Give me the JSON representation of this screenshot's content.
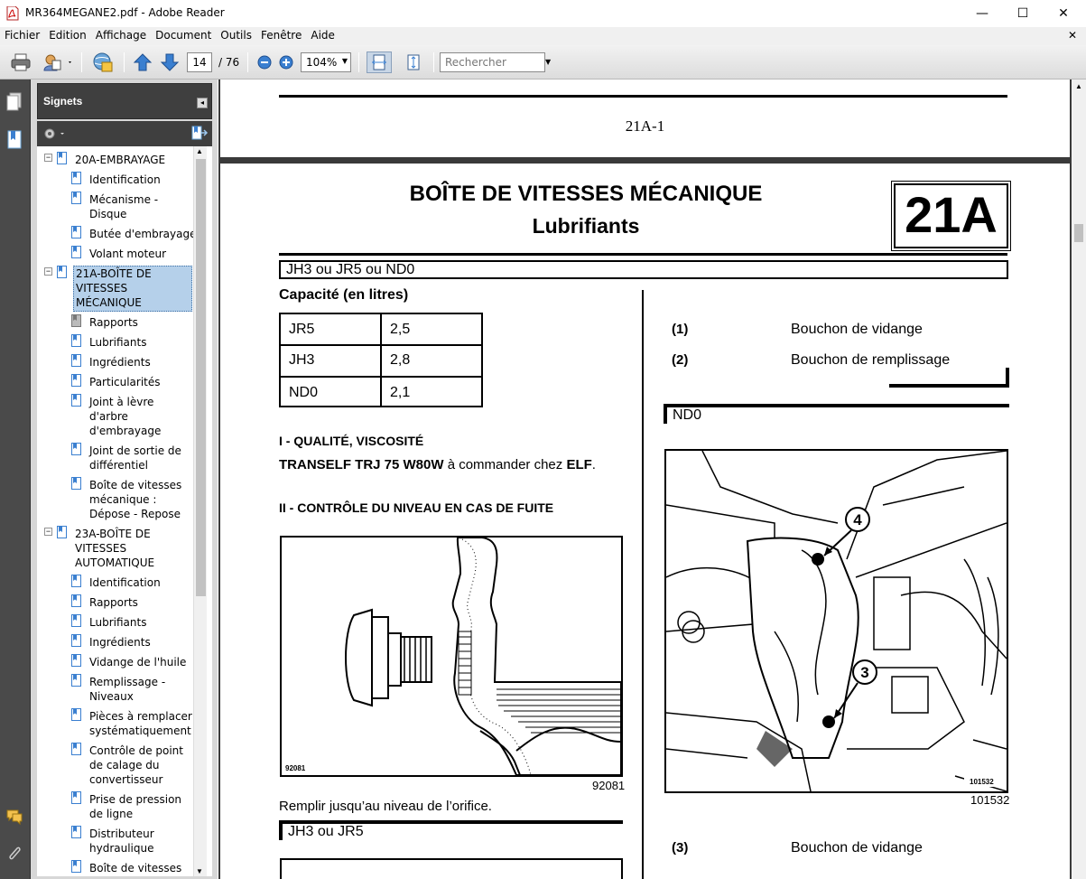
{
  "window": {
    "title": "MR364MEGANE2.pdf - Adobe Reader",
    "controls": [
      "—",
      "☐",
      "✕"
    ]
  },
  "menu": [
    "Fichier",
    "Edition",
    "Affichage",
    "Document",
    "Outils",
    "Fenêtre",
    "Aide"
  ],
  "toolbar": {
    "page_current": "14",
    "page_total": "/ 76",
    "zoom": "104%",
    "search_placeholder": "Rechercher"
  },
  "panel": {
    "title": "Signets",
    "bookmarks": [
      {
        "label": "20A-EMBRAYAGE",
        "level": 0,
        "expander": "⊟"
      },
      {
        "label": "Identification",
        "level": 1
      },
      {
        "label": "Mécanisme -\nDisque",
        "level": 1
      },
      {
        "label": "Butée d'embrayage",
        "level": 1
      },
      {
        "label": "Volant moteur",
        "level": 1
      },
      {
        "label": "21A-BOÎTE DE\nVITESSES\nMÉCANIQUE",
        "level": 0,
        "expander": "⊟",
        "selected": true
      },
      {
        "label": "Rapports",
        "level": 1
      },
      {
        "label": "Lubrifiants",
        "level": 1
      },
      {
        "label": "Ingrédients",
        "level": 1
      },
      {
        "label": "Particularités",
        "level": 1
      },
      {
        "label": "Joint à lèvre\nd'arbre\nd'embrayage",
        "level": 1
      },
      {
        "label": "Joint de sortie de\ndifférentiel",
        "level": 1
      },
      {
        "label": "Boîte de vitesses\nmécanique :\nDépose - Repose",
        "level": 1
      },
      {
        "label": "23A-BOÎTE DE\nVITESSES\nAUTOMATIQUE",
        "level": 0,
        "expander": "⊟"
      },
      {
        "label": "Identification",
        "level": 1
      },
      {
        "label": "Rapports",
        "level": 1
      },
      {
        "label": "Lubrifiants",
        "level": 1
      },
      {
        "label": "Ingrédients",
        "level": 1
      },
      {
        "label": "Vidange de l'huile",
        "level": 1
      },
      {
        "label": "Remplissage -\nNiveaux",
        "level": 1
      },
      {
        "label": "Pièces à remplacer\nsystématiquement",
        "level": 1
      },
      {
        "label": "Contrôle de point\nde calage du\nconvertisseur",
        "level": 1
      },
      {
        "label": "Prise de pression\nde ligne",
        "level": 1
      },
      {
        "label": "Distributeur\nhydraulique",
        "level": 1
      },
      {
        "label": "Boîte de vitesses",
        "level": 1
      }
    ]
  },
  "page_prev": {
    "page_label": "21A-1"
  },
  "page": {
    "title": "BOÎTE DE VITESSES MÉCANIQUE",
    "subtitle": "Lubrifiants",
    "badge": "21A",
    "section_bar": "JH3 ou JR5 ou ND0",
    "capacity_heading": "Capacité (en litres)",
    "capacity_table": [
      {
        "model": "JR5",
        "value": "2,5"
      },
      {
        "model": "JH3",
        "value": "2,8"
      },
      {
        "model": "ND0",
        "value": "2,1"
      }
    ],
    "quality_heading": "I - QUALITÉ, VISCOSITÉ",
    "quality_product": "TRANSELF TRJ 75 W80W",
    "quality_mid": " à commander chez ",
    "quality_brand": "ELF",
    "quality_end": ".",
    "control_heading": "II - CONTRÔLE DU NIVEAU EN CAS DE FUITE",
    "figure1_code_small": "92081",
    "figure1_code": "92081",
    "fill_text": "Remplir jusqu’au niveau de l’orifice.",
    "section2_bar": "JH3 ou JR5",
    "legend_top": [
      {
        "num": "1",
        "text": "Bouchon de vidange"
      },
      {
        "num": "2",
        "text": "Bouchon de remplissage"
      }
    ],
    "section_nd0": "ND0",
    "figure2_callouts": [
      "4",
      "3"
    ],
    "figure2_code_small": "101532",
    "figure2_code": "101532",
    "legend_bottom": [
      {
        "num": "3",
        "text": "Bouchon de vidange"
      }
    ]
  }
}
